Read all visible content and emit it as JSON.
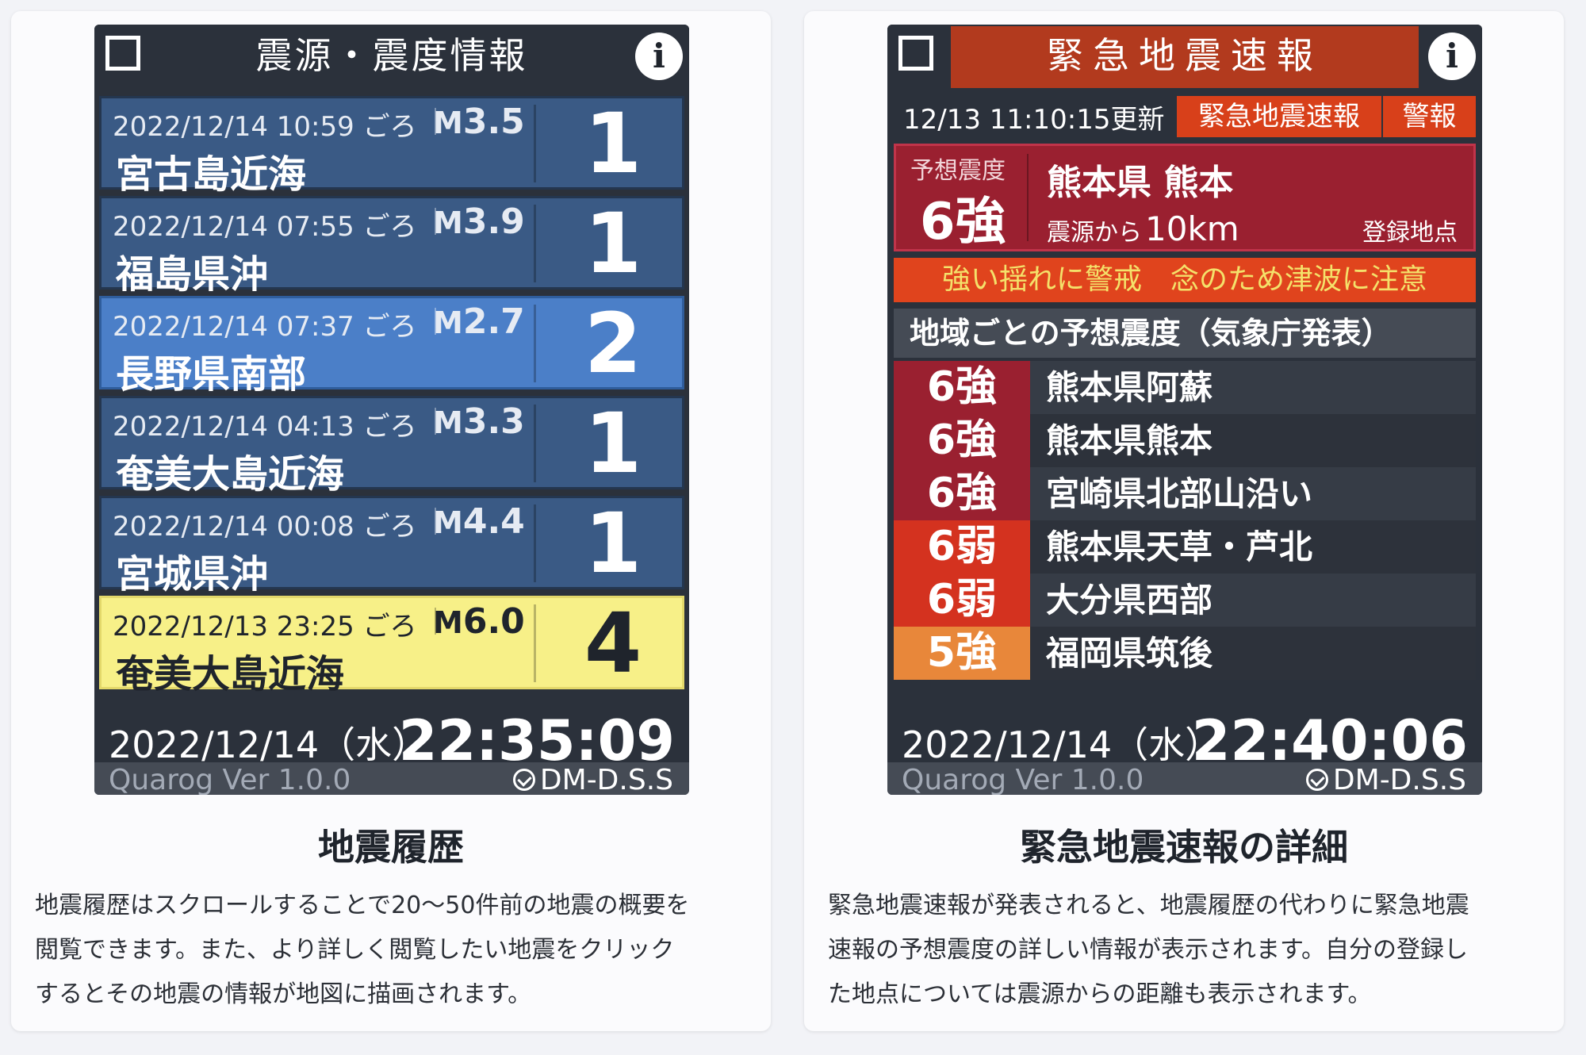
{
  "left": {
    "widget_title": "震源・震度情報",
    "entries": [
      {
        "time": "2022/12/14 10:59 ごろ",
        "mag_prefix": "M",
        "mag": "3.5",
        "place": "宮古島近海",
        "intensity": "1",
        "style": "normal"
      },
      {
        "time": "2022/12/14 07:55 ごろ",
        "mag_prefix": "M",
        "mag": "3.9",
        "place": "福島県沖",
        "intensity": "1",
        "style": "normal"
      },
      {
        "time": "2022/12/14 07:37 ごろ",
        "mag_prefix": "M",
        "mag": "2.7",
        "place": "長野県南部",
        "intensity": "2",
        "style": "selected"
      },
      {
        "time": "2022/12/14 04:13 ごろ",
        "mag_prefix": "M",
        "mag": "3.3",
        "place": "奄美大島近海",
        "intensity": "1",
        "style": "normal"
      },
      {
        "time": "2022/12/14 00:08 ごろ",
        "mag_prefix": "M",
        "mag": "4.4",
        "place": "宮城県沖",
        "intensity": "1",
        "style": "normal"
      },
      {
        "time": "2022/12/13 23:25 ごろ",
        "mag_prefix": "M",
        "mag": "6.0",
        "place": "奄美大島近海",
        "intensity": "4",
        "style": "yellow"
      }
    ],
    "clock_date": "2022/12/14（水）",
    "clock_time": "22:35:09",
    "version": "Quarog Ver 1.0.0",
    "brand": "DM-D.S.S",
    "card_title": "地震履歴",
    "desc_lines": [
      "地震履歴はスクロールすることで20〜50件前の地震の概要を",
      "閲覧できます。また、より詳しく閲覧したい地震をクリック",
      "するとその地震の情報が地図に描画されます。"
    ]
  },
  "right": {
    "widget_title": "緊急地震速報",
    "updated": "12/13 11:10:15更新",
    "tag_eew": "緊急地震速報",
    "tag_warning": "警報",
    "forecast_label": "予想震度",
    "forecast_intensity": "6強",
    "location": "熊本県 熊本",
    "distance_label": "震源から",
    "distance": "10km",
    "registered_label": "登録地点",
    "alert_text": "強い揺れに警戒　念のため津波に注意",
    "regions_header": "地域ごとの予想震度（気象庁発表）",
    "regions": [
      {
        "intensity": "6強",
        "name": "熊本県阿蘇",
        "color": "#9a2030"
      },
      {
        "intensity": "6強",
        "name": "熊本県熊本",
        "color": "#9a2030"
      },
      {
        "intensity": "6強",
        "name": "宮崎県北部山沿い",
        "color": "#9a2030"
      },
      {
        "intensity": "6弱",
        "name": "熊本県天草・芦北",
        "color": "#d4321f"
      },
      {
        "intensity": "6弱",
        "name": "大分県西部",
        "color": "#d4321f"
      },
      {
        "intensity": "5強",
        "name": "福岡県筑後",
        "color": "#e8873a"
      }
    ],
    "clock_date": "2022/12/14（水）",
    "clock_time": "22:40:06",
    "version": "Quarog Ver 1.0.0",
    "brand": "DM-D.S.S",
    "card_title": "緊急地震速報の詳細",
    "desc_lines": [
      "緊急地震速報が発表されると、地震履歴の代わりに緊急地震",
      "速報の予想震度の詳しい情報が表示されます。自分の登録し",
      "た地点については震源からの距離も表示されます。"
    ]
  },
  "colors": {
    "widget_bg": "#2b313b",
    "entry_blue": "#3a5a85",
    "entry_selected": "#4b7fc8",
    "entry_yellow": "#f7f088",
    "eew_red": "#b23a1e",
    "alert_orange": "#e0441d"
  }
}
